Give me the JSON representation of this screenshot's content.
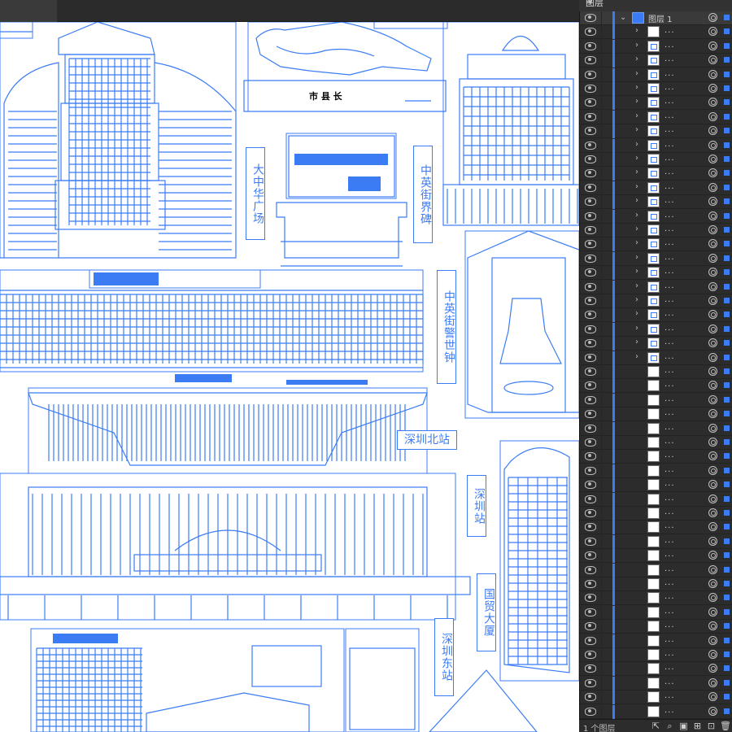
{
  "panel": {
    "tab_label": "图层",
    "top_layer_name": "图层 1",
    "sublayer_name": "...",
    "footer_count": "1 个图层",
    "accent_color": "#3b7cf5",
    "footer_icons": [
      "export-icon",
      "search-icon",
      "clip-mask-icon",
      "new-sublayer-icon",
      "new-layer-icon",
      "trash-icon"
    ]
  },
  "canvas": {
    "labels": {
      "dazhonghua": "大中华广场",
      "zhongying_bei": "中英街界碑",
      "zhongying_zhong": "中英街警世钟",
      "shenzhen_bei": "深圳北站",
      "shenzhen_zhan": "深圳站",
      "guomao": "国贸大厦",
      "shenzhen_dong": "深圳东站"
    }
  }
}
